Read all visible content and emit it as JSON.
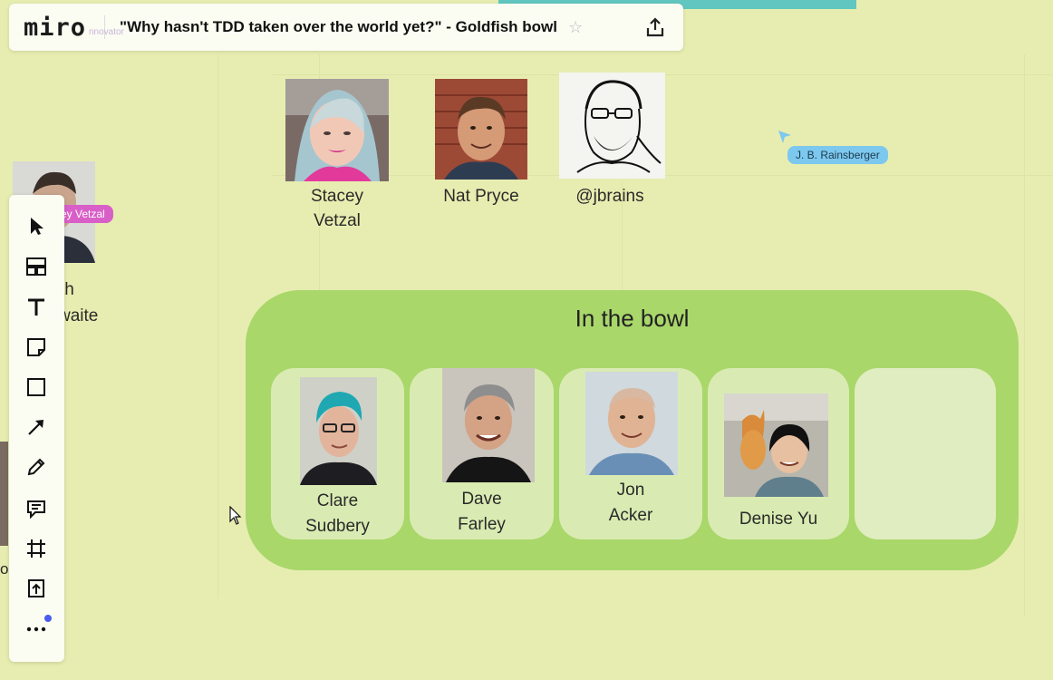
{
  "topbar": {
    "logo": "miro",
    "board_title": "\"Why hasn't TDD taken over the world yet?\" - Goldfish bowl",
    "ghost_text": "nnovator"
  },
  "observers": [
    {
      "name_line1": "Stacey",
      "name_line2": "Vetzal"
    },
    {
      "name_line1": "Nat Pryce"
    },
    {
      "name_line1": "@jbrains"
    }
  ],
  "left_person": {
    "name_line1": "th",
    "name_line2": "waite"
  },
  "left_edge_text": "o",
  "cursor_tags": {
    "stacey": "ey Vetzal",
    "jb": "J. B. Rainsberger"
  },
  "bowl": {
    "title": "In the bowl",
    "seats": [
      {
        "line1": "Clare",
        "line2": "Sudbery"
      },
      {
        "line1": "Dave",
        "line2": "Farley"
      },
      {
        "line1": "Jon",
        "line2": "Acker"
      },
      {
        "line1": "Denise Yu"
      },
      {}
    ]
  },
  "toolbar": {
    "tools": [
      "select-icon",
      "templates-icon",
      "text-icon",
      "sticky-note-icon",
      "shape-icon",
      "connection-line-icon",
      "pen-icon",
      "comment-icon",
      "frame-icon",
      "upload-icon",
      "more-icon"
    ]
  },
  "colors": {
    "canvas": "#e7edb0",
    "bowl": "#a9d76a",
    "seat": "#d9ebb2",
    "accent_pink": "#d95fc8",
    "accent_blue": "#7cc8ef",
    "teal": "#62c6c0"
  }
}
